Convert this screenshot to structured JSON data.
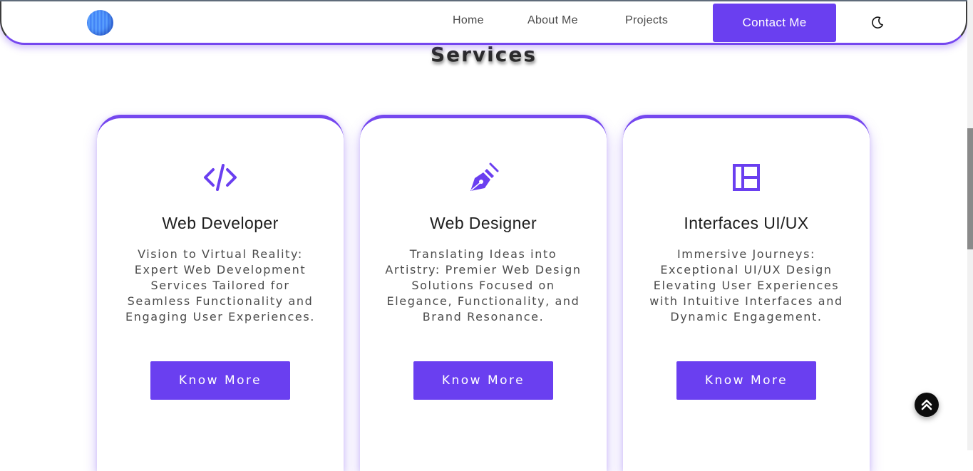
{
  "nav": {
    "links": [
      {
        "label": "Home"
      },
      {
        "label": "About Me"
      },
      {
        "label": "Projects"
      }
    ],
    "contact_label": "Contact Me",
    "theme_icon": "moon-icon",
    "logo_icon": "sphere-logo-icon"
  },
  "section": {
    "title": "Services"
  },
  "cards": [
    {
      "icon": "code-icon",
      "title": "Web Developer",
      "description": "Vision to Virtual Reality: Expert Web Development Services Tailored for Seamless Functionality and Engaging User Experiences.",
      "button_label": "Know More"
    },
    {
      "icon": "pen-nib-icon",
      "title": "Web Designer",
      "description": "Translating Ideas into Artistry: Premier Web Design Solutions Focused on Elegance, Functionality, and Brand Resonance.",
      "button_label": "Know More"
    },
    {
      "icon": "layout-icon",
      "title": "Interfaces UI/UX",
      "description": "Immersive Journeys: Exceptional UI/UX Design Elevating User Experiences with Intuitive Interfaces and Dynamic Engagement.",
      "button_label": "Know More"
    }
  ],
  "scroll_top_icon": "double-chevron-up-icon",
  "colors": {
    "accent": "#6a3ff0",
    "text_dark": "#1d1d1d",
    "text_muted": "#4b4b4b"
  }
}
